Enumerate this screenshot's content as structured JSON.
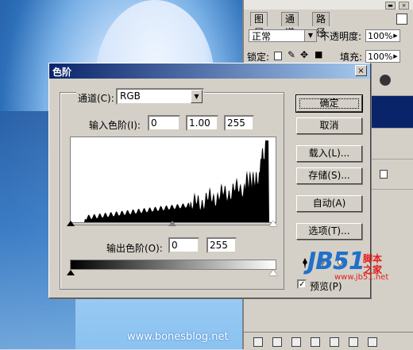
{
  "photo": {
    "watermark": "www.bonesblog.net"
  },
  "panel": {
    "tabs": [
      {
        "label": "图层"
      },
      {
        "label": "通道"
      },
      {
        "label": "路径"
      }
    ],
    "blend_mode": "正常",
    "opacity_label": "不透明度:",
    "opacity_value": "100%",
    "lock_label": "锁定:",
    "fill_label": "填充:",
    "fill_value": "100%"
  },
  "dialog": {
    "title": "色阶",
    "close": "×",
    "channel_label": "通道(C):",
    "channel_value": "RGB",
    "input_levels_label": "输入色阶(I):",
    "input_levels": [
      "0",
      "1.00",
      "255"
    ],
    "output_levels_label": "输出色阶(O):",
    "output_levels": [
      "0",
      "255"
    ],
    "buttons": {
      "ok": "确定",
      "cancel": "取消",
      "load": "载入(L)...",
      "save": "存储(S)...",
      "auto": "自动(A)",
      "options": "选项(T)..."
    },
    "preview_label": "预览(P)"
  },
  "logo": {
    "brand": "JB51",
    "line1": "脚本",
    "line2": "之家",
    "url": "www.jb51.net"
  },
  "colors": {
    "titlebar_start": "#0a246a",
    "titlebar_end": "#a6caf0",
    "dialog_bg": "#d4d0c8",
    "logo_blue": "#2170c9",
    "logo_red": "#e31c1c"
  }
}
